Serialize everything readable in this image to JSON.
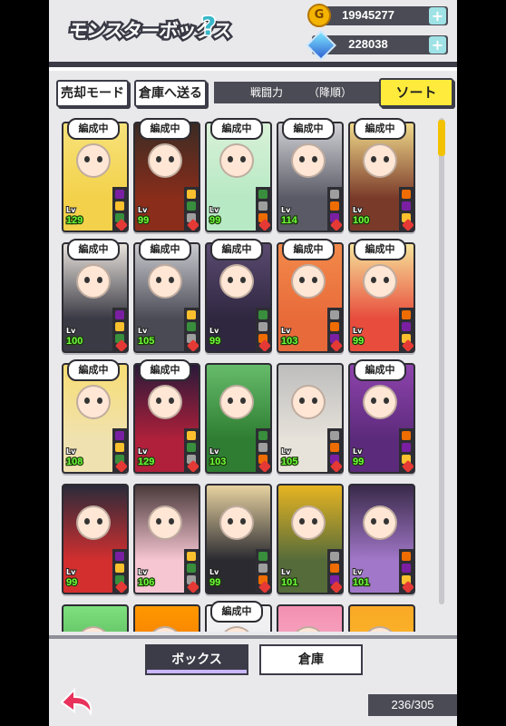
{
  "header": {
    "title": "モンスターボックス",
    "help_icon": "?",
    "coins": "19945277",
    "gems": "228038",
    "add_label": "+"
  },
  "toolbar": {
    "sell_mode": "売却モード",
    "to_storage": "倉庫へ送る",
    "sort_key": "戦闘力",
    "sort_order": "（降順）",
    "sort_button": "ソート"
  },
  "badge_text": "編成中",
  "cards": [
    {
      "lv": "129",
      "deployed": true,
      "color": "#f3d14a",
      "hair": "#f7e27a"
    },
    {
      "lv": "99",
      "deployed": true,
      "color": "#8a2d1a",
      "hair": "#3b2b24"
    },
    {
      "lv": "99",
      "deployed": true,
      "color": "#b7e9c4",
      "hair": "#d9f1d8"
    },
    {
      "lv": "114",
      "deployed": true,
      "color": "#5a5a66",
      "hair": "#d1d1d6"
    },
    {
      "lv": "100",
      "deployed": true,
      "color": "#7a3a2a",
      "hair": "#f0d98a"
    },
    {
      "lv": "100",
      "deployed": true,
      "color": "#3a3a44",
      "hair": "#e8e2dc"
    },
    {
      "lv": "105",
      "deployed": true,
      "color": "#4a4a55",
      "hair": "#c9c9cf"
    },
    {
      "lv": "99",
      "deployed": true,
      "color": "#2f2740",
      "hair": "#5a4a70"
    },
    {
      "lv": "103",
      "deployed": true,
      "color": "#e86a3a",
      "hair": "#f28a4a"
    },
    {
      "lv": "99",
      "deployed": true,
      "color": "#e74c3c",
      "hair": "#f6e39a"
    },
    {
      "lv": "108",
      "deployed": true,
      "color": "#f0e2b0",
      "hair": "#f7dd74"
    },
    {
      "lv": "129",
      "deployed": true,
      "color": "#b0203a",
      "hair": "#2a1a3a"
    },
    {
      "lv": "103",
      "deployed": false,
      "color": "#2e7d32",
      "hair": "#66bb6a"
    },
    {
      "lv": "105",
      "deployed": false,
      "color": "#e7e2da",
      "hair": "#bdbdbd"
    },
    {
      "lv": "99",
      "deployed": true,
      "color": "#5b2a7a",
      "hair": "#8e44ad"
    },
    {
      "lv": "99",
      "deployed": false,
      "color": "#d32f2f",
      "hair": "#2b2b3a"
    },
    {
      "lv": "106",
      "deployed": false,
      "color": "#f6c6d3",
      "hair": "#4a3a3a"
    },
    {
      "lv": "99",
      "deployed": false,
      "color": "#2a2a30",
      "hair": "#e7d2a0"
    },
    {
      "lv": "101",
      "deployed": false,
      "color": "#556b3a",
      "hair": "#e6b422"
    },
    {
      "lv": "101",
      "deployed": false,
      "color": "#a178c9",
      "hair": "#3a2a4a"
    },
    {
      "lv": "",
      "deployed": false,
      "color": "#43a047",
      "hair": "#7ee07e"
    },
    {
      "lv": "",
      "deployed": false,
      "color": "#ef6c00",
      "hair": "#ff9800"
    },
    {
      "lv": "",
      "deployed": true,
      "color": "#e7e4ec",
      "hair": "#f3f3f3"
    },
    {
      "lv": "",
      "deployed": false,
      "color": "#f8bbd0",
      "hair": "#f48fb1"
    },
    {
      "lv": "",
      "deployed": false,
      "color": "#fbc02d",
      "hair": "#f9a825"
    }
  ],
  "lv_label": "Lv",
  "tabs": {
    "box": "ボックス",
    "storage": "倉庫"
  },
  "box_count": "236/305",
  "colors": {
    "accent_yellow": "#ffeb3b",
    "dark_panel": "#3c3c48",
    "level_green": "#6fff3a"
  }
}
